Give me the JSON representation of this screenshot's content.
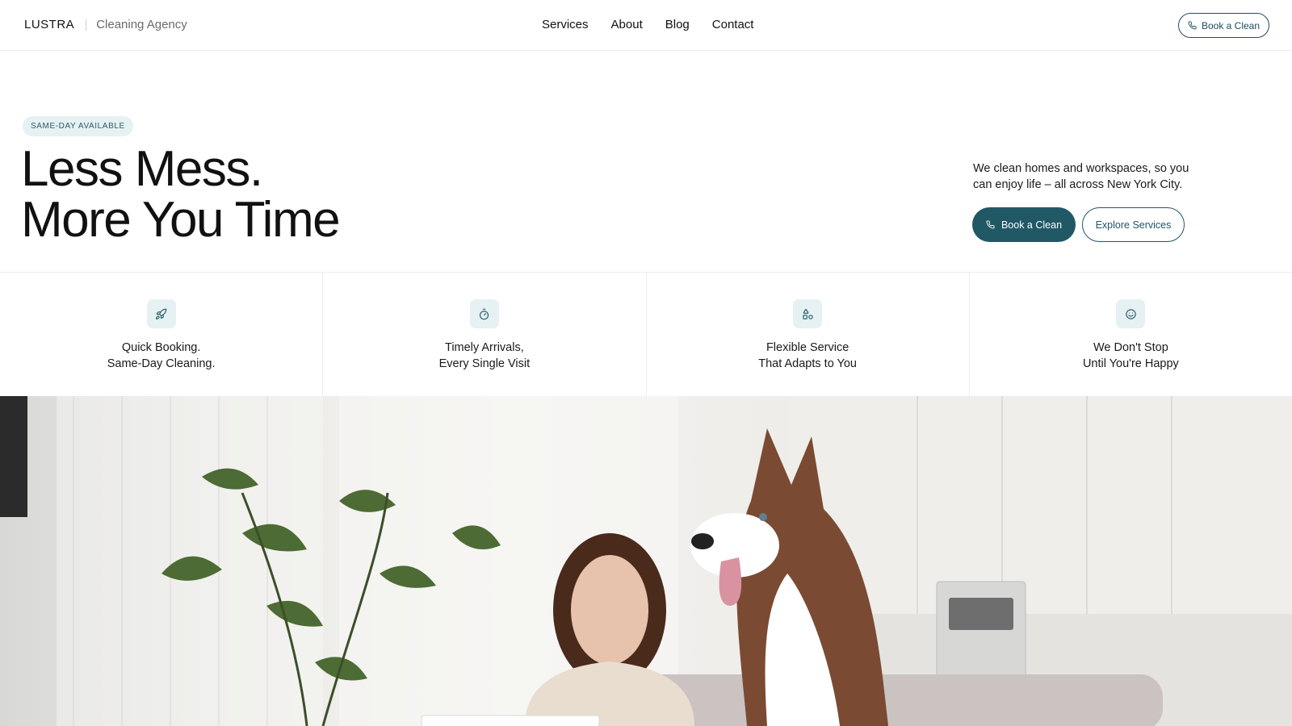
{
  "header": {
    "brand": "LUSTRA",
    "tagline": "Cleaning Agency",
    "nav": [
      "Services",
      "About",
      "Blog",
      "Contact"
    ],
    "cta_label": "Book a Clean"
  },
  "hero": {
    "badge": "SAME-DAY AVAILABLE",
    "headline_line1": "Less Mess.",
    "headline_line2": "More You Time",
    "description": "We clean homes and workspaces, so you can enjoy life – all across New York City.",
    "primary_cta": "Book a Clean",
    "secondary_cta": "Explore Services"
  },
  "features": [
    {
      "icon": "rocket-icon",
      "line1": "Quick Booking.",
      "line2": "Same-Day Cleaning."
    },
    {
      "icon": "stopwatch-icon",
      "line1": "Timely Arrivals,",
      "line2": "Every Single Visit"
    },
    {
      "icon": "shapes-icon",
      "line1": "Flexible Service",
      "line2": "That Adapts to You"
    },
    {
      "icon": "smiley-icon",
      "line1": "We Don't Stop",
      "line2": "Until You're Happy"
    }
  ],
  "colors": {
    "accent": "#215866",
    "badge_bg": "#e6f1f3",
    "border": "#ececec"
  }
}
